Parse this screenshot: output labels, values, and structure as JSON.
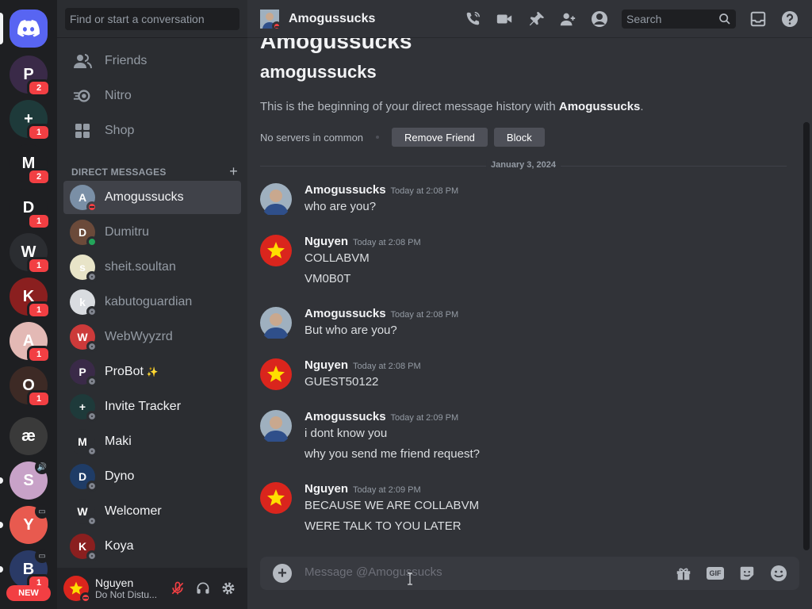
{
  "search": {
    "find_placeholder": "Find or start a conversation",
    "header_search": "Search"
  },
  "nav": [
    {
      "label": "Friends",
      "icon": "friends-icon"
    },
    {
      "label": "Nitro",
      "icon": "nitro-icon"
    },
    {
      "label": "Shop",
      "icon": "shop-icon"
    }
  ],
  "dm_header": {
    "label": "DIRECT MESSAGES",
    "add": "+"
  },
  "dms": [
    {
      "name": "Amogussucks",
      "status": "dnd",
      "color": "#7a8fa6",
      "initial": "A"
    },
    {
      "name": "Dumitru",
      "status": "online",
      "color": "#6b4a3a",
      "initial": "D"
    },
    {
      "name": "sheit.soultan",
      "status": "offline",
      "color": "#e8e4c8",
      "initial": "s"
    },
    {
      "name": "kabutoguardian",
      "status": "offline",
      "color": "#d9dce0",
      "initial": "k"
    },
    {
      "name": "WebWyyzrd",
      "status": "offline",
      "color": "#cc3a3a",
      "initial": "W"
    },
    {
      "name": "ProBot",
      "status": "offline",
      "color": "#3a2a48",
      "initial": "P",
      "badge": "✨"
    },
    {
      "name": "Invite Tracker",
      "status": "offline",
      "color": "#1e3a3a",
      "initial": "+"
    },
    {
      "name": "Maki",
      "status": "offline",
      "color": "#2b2d31",
      "initial": "M"
    },
    {
      "name": "Dyno",
      "status": "offline",
      "color": "#1f3c66",
      "initial": "D"
    },
    {
      "name": "Welcomer",
      "status": "offline",
      "color": "#2b2d31",
      "initial": "W"
    },
    {
      "name": "Koya",
      "status": "offline",
      "color": "#8a1f1f",
      "initial": "K"
    }
  ],
  "servers": [
    {
      "name": "home",
      "badge": ""
    },
    {
      "name": "P",
      "color": "#3a2a48",
      "badge": "2"
    },
    {
      "name": "+",
      "color": "#1e3a3a",
      "badge": "1"
    },
    {
      "name": "M",
      "color": "#1e1f22",
      "badge": "2"
    },
    {
      "name": "D",
      "color": "#1e1f22",
      "badge": "1"
    },
    {
      "name": "W",
      "color": "#2b2d31",
      "badge": "1"
    },
    {
      "name": "K",
      "color": "#8a1f1f",
      "badge": "1"
    },
    {
      "name": "A",
      "color": "#e3b9b5",
      "badge": "1"
    },
    {
      "name": "O",
      "color": "#3d2a25",
      "badge": "1"
    },
    {
      "name": "æ",
      "color": "#3a3a3a",
      "badge": ""
    },
    {
      "name": "S",
      "color": "#c8a2c8",
      "badge": ""
    },
    {
      "name": "Y",
      "color": "#e85a4f",
      "badge": ""
    },
    {
      "name": "B",
      "color": "#2a3a66",
      "badge": "1"
    }
  ],
  "rail": {
    "new_label": "NEW"
  },
  "user": {
    "name": "Nguyen",
    "status": "Do Not Distu..."
  },
  "header": {
    "name": "Amogussucks"
  },
  "chat": {
    "big_title": "Amogussucks",
    "username": "amogussucks",
    "intro_prefix": "This is the beginning of your direct message history with ",
    "intro_name": "Amogussucks",
    "intro_suffix": ".",
    "no_servers": "No servers in common",
    "remove_friend": "Remove Friend",
    "block": "Block",
    "date_divider": "January 3, 2024"
  },
  "messages": [
    {
      "author": "Amogussucks",
      "time": "Today at 2:08 PM",
      "lines": [
        "who are you?"
      ],
      "avatar": "photo"
    },
    {
      "author": "Nguyen",
      "time": "Today at 2:08 PM",
      "lines": [
        "COLLABVM",
        "VM0B0T"
      ],
      "avatar": "star"
    },
    {
      "author": "Amogussucks",
      "time": "Today at 2:08 PM",
      "lines": [
        "But who are you?"
      ],
      "avatar": "photo"
    },
    {
      "author": "Nguyen",
      "time": "Today at 2:08 PM",
      "lines": [
        "GUEST50122"
      ],
      "avatar": "star"
    },
    {
      "author": "Amogussucks",
      "time": "Today at 2:09 PM",
      "lines": [
        "i dont know you",
        "why you send me friend request?"
      ],
      "avatar": "photo"
    },
    {
      "author": "Nguyen",
      "time": "Today at 2:09 PM",
      "lines": [
        "BECAUSE WE ARE COLLABVM",
        "WERE TALK TO  YOU LATER"
      ],
      "avatar": "star"
    }
  ],
  "composer": {
    "placeholder": "Message @Amogussucks"
  }
}
